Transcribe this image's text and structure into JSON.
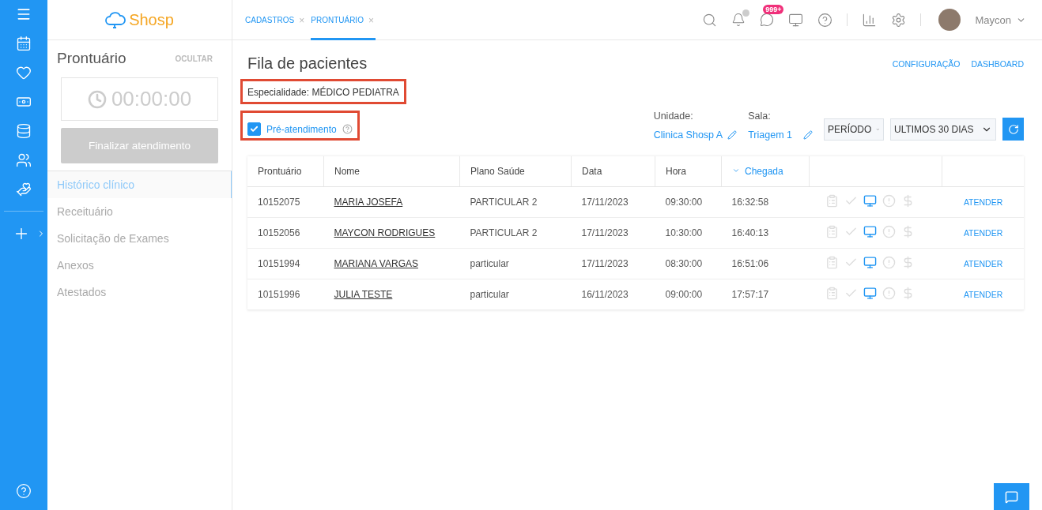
{
  "brand": {
    "name": "Shosp"
  },
  "tabs": [
    {
      "label": "CADASTROS",
      "close": "×",
      "selected": false
    },
    {
      "label": "PRONTUÁRIO",
      "close": "×",
      "selected": true
    }
  ],
  "topbar": {
    "messages_badge": "999+",
    "notifications_dot": true,
    "user": "Maycon"
  },
  "panel": {
    "title": "Prontuário",
    "hide": "OCULTAR",
    "timer": "00:00:00",
    "finish_button": {
      "label": "Finalizar atendimento",
      "disabled": true
    },
    "menu": [
      {
        "label": "Histórico clínico",
        "selected": true
      },
      {
        "label": "Receituário",
        "selected": false
      },
      {
        "label": "Solicitação de Exames",
        "selected": false
      },
      {
        "label": "Anexos",
        "selected": false
      },
      {
        "label": "Atestados",
        "selected": false
      }
    ]
  },
  "page": {
    "title": "Fila de pacientes",
    "links": [
      "CONFIGURAÇÃO",
      "DASHBOARD"
    ],
    "specialty": "Especialidade: MÉDICO PEDIATRA",
    "pre_attendance": {
      "label": "Pré-atendimento",
      "checked": true
    },
    "unit": {
      "label": "Unidade:",
      "value": "Clinica Shosp A"
    },
    "room": {
      "label": "Sala:",
      "value": "Triagem 1"
    },
    "period_select": {
      "value": "PERÍODO"
    },
    "range_select": {
      "value": "ULTIMOS 30 DIAS"
    }
  },
  "table": {
    "columns": [
      {
        "label": "Prontuário",
        "sorted": false
      },
      {
        "label": "Nome",
        "sorted": false
      },
      {
        "label": "Plano Saúde",
        "sorted": false
      },
      {
        "label": "Data",
        "sorted": false
      },
      {
        "label": "Hora",
        "sorted": false
      },
      {
        "label": "Chegada",
        "sorted": true
      }
    ],
    "rows": [
      {
        "record": "10152075",
        "name": "MARIA JOSEFA",
        "plan": "PARTICULAR 2",
        "date": "17/11/2023",
        "time": "09:30:00",
        "arrival": "16:32:58",
        "flags": {
          "triage": false,
          "confirmed": false,
          "online": true,
          "alert": false,
          "paid": false
        },
        "action": "ATENDER"
      },
      {
        "record": "10152056",
        "name": "MAYCON RODRIGUES",
        "plan": "PARTICULAR 2",
        "date": "17/11/2023",
        "time": "10:30:00",
        "arrival": "16:40:13",
        "flags": {
          "triage": false,
          "confirmed": false,
          "online": true,
          "alert": false,
          "paid": false
        },
        "action": "ATENDER"
      },
      {
        "record": "10151994",
        "name": "MARIANA VARGAS",
        "plan": "particular",
        "date": "17/11/2023",
        "time": "08:30:00",
        "arrival": "16:51:06",
        "flags": {
          "triage": false,
          "confirmed": false,
          "online": true,
          "alert": false,
          "paid": false
        },
        "action": "ATENDER"
      },
      {
        "record": "10151996",
        "name": "JULIA TESTE",
        "plan": "particular",
        "date": "16/11/2023",
        "time": "09:00:00",
        "arrival": "17:57:17",
        "flags": {
          "triage": false,
          "confirmed": false,
          "online": true,
          "alert": false,
          "paid": false
        },
        "action": "ATENDER"
      }
    ]
  }
}
